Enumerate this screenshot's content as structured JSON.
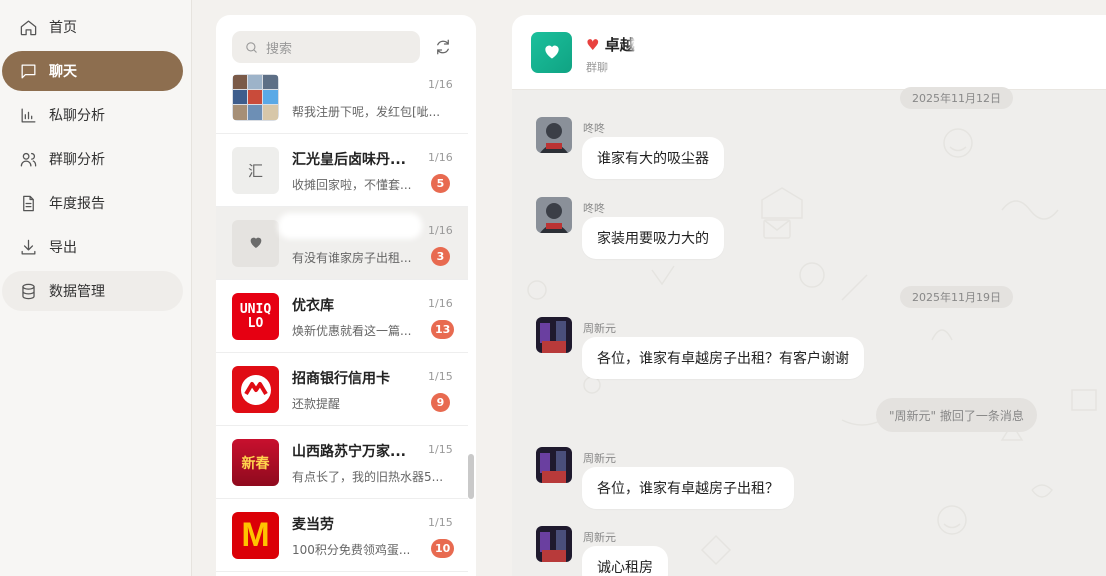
{
  "nav": [
    {
      "label": "首页",
      "icon": "home-icon",
      "active": false
    },
    {
      "label": "聊天",
      "icon": "chat-bubble-icon",
      "active": true
    },
    {
      "label": "私聊分析",
      "icon": "bar-chart-icon",
      "active": false
    },
    {
      "label": "群聊分析",
      "icon": "users-icon",
      "active": false
    },
    {
      "label": "年度报告",
      "icon": "document-icon",
      "active": false
    },
    {
      "label": "导出",
      "icon": "download-icon",
      "active": false
    },
    {
      "label": "数据管理",
      "icon": "database-icon",
      "active": false
    }
  ],
  "search": {
    "placeholder": "搜索",
    "icon": "search-icon"
  },
  "refresh_icon": "refresh-icon",
  "chats": [
    {
      "name": "",
      "time": "1/16",
      "preview": "帮我注册下呢，发红包[呲...",
      "badge": ""
    },
    {
      "name": "汇光皇后卤味丹...",
      "time": "1/16",
      "preview": "收摊回家啦，不懂套...",
      "badge": "5",
      "avatar_text": "汇"
    },
    {
      "name": "",
      "time": "1/16",
      "preview": "有没有谁家房子出租...",
      "badge": "3"
    },
    {
      "name": "优衣库",
      "time": "1/16",
      "preview": "焕新优惠就看这一篇...",
      "badge": "13",
      "avatar_text": "UNIQLO"
    },
    {
      "name": "招商银行信用卡",
      "time": "1/15",
      "preview": "还款提醒",
      "badge": "9"
    },
    {
      "name": "山西路苏宁万家...",
      "time": "1/15",
      "preview": "有点长了，我的旧热水器5...",
      "badge": "",
      "avatar_text": "新春"
    },
    {
      "name": "麦当劳",
      "time": "1/15",
      "preview": "100积分免费领鸡蛋...",
      "badge": "10",
      "avatar_text": "M"
    }
  ],
  "group": {
    "title": "卓越",
    "subtitle": "群聊",
    "icon": "heart-icon"
  },
  "messages": {
    "date1": "2025年11月12日",
    "date2": "2025年11月19日",
    "m1": {
      "sender": "咚咚",
      "text": "谁家有大的吸尘器"
    },
    "m2": {
      "sender": "咚咚",
      "text": "家装用要吸力大的"
    },
    "m3": {
      "sender": "周新元",
      "text": "各位，谁家有卓越房子出租？有客户谢谢"
    },
    "recall": "\"周新元\" 撤回了一条消息",
    "m4": {
      "sender": "周新元",
      "text": "各位，谁家有卓越房子出租？"
    },
    "m5": {
      "sender": "周新元",
      "text": "诚心租房"
    }
  },
  "colors": {
    "accent": "#8d6e4f",
    "badge": "#e86a50",
    "group_avatar": "#1bc09c"
  }
}
